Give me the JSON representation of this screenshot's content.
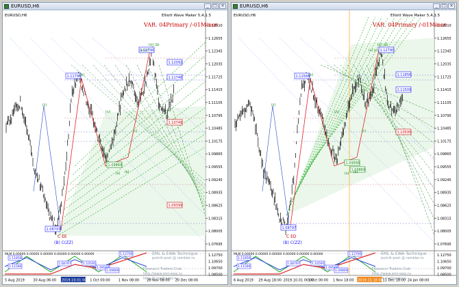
{
  "panels": [
    {
      "key": "left",
      "title": "EURUSD,H6",
      "symbol_label": "EURUSD,H6",
      "indicator": "Elliott Wave Maker 5,4,1.5",
      "variant": "VAR. 04Primary /-01Minor",
      "price_labels": [
        "1.12910",
        "1.12655",
        "1.12345",
        "1.12035",
        "1.11725",
        "1.11415",
        "1.11105",
        "1.10795",
        "1.10485",
        "1.10175",
        "1.09865",
        "1.09555",
        "1.09245",
        "1.08935",
        "1.08625",
        "1.08315",
        "1.08005",
        "1.07695"
      ],
      "boxes": [
        {
          "text": "1.12790",
          "color": "#1a1aff"
        },
        {
          "text": "1.12092",
          "color": "#1a1aff"
        },
        {
          "text": "1.11796",
          "color": "#1a1aff"
        },
        {
          "text": "1.11746",
          "color": "#1a1aff"
        },
        {
          "text": "1.10749",
          "color": "#cc0000"
        },
        {
          "text": "1.09399",
          "color": "#cc0000"
        },
        {
          "text": "1.08797",
          "color": "#1a1aff"
        },
        {
          "text": "1.09869",
          "color": "#008000"
        }
      ],
      "wave_labels": [
        "[iii] (D)",
        "[ii]",
        "[iii]",
        "[iv]",
        "[c]",
        "[a]",
        "[b]",
        "[v] [c]",
        "C EE",
        "(B) C(ZZ)"
      ],
      "osc_title": "MLM 0.00000 0.00000 0.00000 0.00000 0.00000 0.00000",
      "osc_boxes": [
        "1.12790",
        "1.11856",
        "1.11584",
        "1.10595",
        "1.09566",
        "1.08797",
        "1.09869"
      ],
      "osc_levels": [
        "1.12790",
        "1.09869"
      ],
      "watermark": [
        "EML & EWA Technique",
        "putnik-post @ rambler.ru",
        "Fibonacci Traders Club",
        "http://www.eml-ewa.ru",
        "http://t.me/trader.ru"
      ],
      "time_labels": [
        "5 Aug 2019",
        "30 Aug 06:00",
        "2019.10.01 00:00",
        "1 Oct 00:00",
        "1 Nov 08:00",
        "28 Nov 08:00",
        "20 Dec 08:00"
      ],
      "highlight_time": "2019.10.01 00:00",
      "osc_axis": [
        "1.12750",
        "1.10650",
        "1.09700",
        "1.08500"
      ]
    },
    {
      "key": "right",
      "title": "EURUSD,H6",
      "symbol_label": "EURUSD,H6",
      "indicator": "Elliott Wave Maker 5,4,1.5",
      "variant": "VAR. 04Primary /-01Minor",
      "price_labels": [
        "1.12910",
        "1.12655",
        "1.12345",
        "1.12035",
        "1.11725",
        "1.11415",
        "1.11105",
        "1.10795",
        "1.10485",
        "1.10175",
        "1.09865",
        "1.09555",
        "1.09245",
        "1.08935",
        "1.08625",
        "1.08315",
        "1.08005",
        "1.07695"
      ],
      "boxes": [
        {
          "text": "1.12790",
          "color": "#1a1aff"
        },
        {
          "text": "1.11856",
          "color": "#1a1aff"
        },
        {
          "text": "1.11584",
          "color": "#1a1aff"
        },
        {
          "text": "1.11509",
          "color": "#1a1aff"
        },
        {
          "text": "1.10595",
          "color": "#cc0000"
        },
        {
          "text": "1.08797",
          "color": "#1a1aff"
        },
        {
          "text": "1.09869",
          "color": "#008000"
        },
        {
          "text": "1.09566",
          "color": "#008000"
        }
      ],
      "wave_labels": [
        "[iii] (D)",
        "[ii]",
        "[iii]",
        "[iv]",
        "[c]",
        "[a]",
        "[b]",
        "[v] [c]",
        "C ED",
        "(B) C(ZZ)"
      ],
      "osc_title": "MLM 0.00000 0.00000 0.00000 0.00000 0.00000 0.00000",
      "osc_boxes": [
        "1.12790",
        "1.11856",
        "1.11584",
        "1.10595",
        "1.09566",
        "1.08797",
        "1.09869"
      ],
      "osc_levels": [
        "1.12790",
        "1.09869"
      ],
      "watermark": [
        "EML & EWA Technique",
        "putnik-post @ rambler.ru",
        "Fibonacci Traders Club",
        "http://www.eml-ewa.ru",
        "http://t.me/trader.ru"
      ],
      "time_labels": [
        "6 Aug 2019",
        "29 Aug 18:00",
        "2019.10.01 00:00",
        "1 Oct 00:00",
        "1 Nov 18:00",
        "2019.11.18 00:00",
        "11 Dec 18:00",
        "24 Jan 08:00"
      ],
      "highlight_time": "2019.11.18 00:00",
      "osc_axis": [
        "1.12750",
        "1.10650",
        "1.09700",
        "1.08500"
      ]
    }
  ],
  "colors": {
    "bull": "#000000",
    "fib_green": "#22aa22",
    "fib_blue": "#3355ff",
    "red": "#dd2222",
    "box_blue": "#1a1aff",
    "grid": "#c8c8c8"
  },
  "window_buttons": [
    "_",
    "□",
    "×"
  ]
}
